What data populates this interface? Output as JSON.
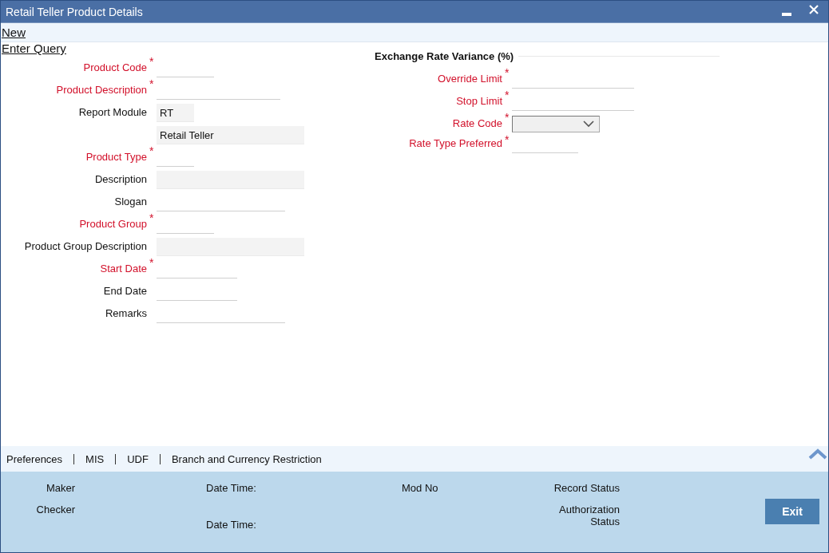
{
  "window": {
    "title": "Retail Teller Product Details"
  },
  "toolbar": {
    "links": [
      "New",
      "Enter Query"
    ]
  },
  "required_marker": "*",
  "fields_left": [
    {
      "label": "Product Code",
      "required": true,
      "kind": "line"
    },
    {
      "label": "Product Description",
      "required": true,
      "kind": "line"
    },
    {
      "label": "Report Module",
      "required": false,
      "kind": "readonly",
      "value": "RT"
    },
    {
      "required": false,
      "kind": "readonly",
      "value": "Retail Teller"
    },
    {
      "label": "Product Type",
      "required": true,
      "kind": "line"
    },
    {
      "label": "Description",
      "required": false,
      "kind": "readonly"
    },
    {
      "label": "Slogan",
      "required": false,
      "kind": "line"
    },
    {
      "label": "Product Group",
      "required": true,
      "kind": "line"
    },
    {
      "label": "Product Group Description",
      "required": false,
      "kind": "readonly"
    },
    {
      "label": "Start Date",
      "required": true,
      "kind": "line"
    },
    {
      "label": "End Date",
      "required": false,
      "kind": "line"
    },
    {
      "label": "Remarks",
      "required": false,
      "kind": "line"
    }
  ],
  "exchange_section": {
    "title": "Exchange Rate Variance (%)",
    "fields": [
      {
        "label": "Override Limit",
        "required": true,
        "kind": "line"
      },
      {
        "label": "Stop Limit",
        "required": true,
        "kind": "line"
      },
      {
        "label": "Rate Code",
        "required": true,
        "kind": "select"
      },
      {
        "label": "Rate Type Preferred",
        "required": true,
        "kind": "line"
      }
    ]
  },
  "bottom_tabs": [
    "Preferences",
    "MIS",
    "UDF",
    "Branch and Currency Restriction"
  ],
  "footer": {
    "maker_label": "Maker",
    "checker_label": "Checker",
    "date_time_labels": [
      "Date Time:",
      "Date Time:"
    ],
    "mod_no_label": "Mod No",
    "record_status_label": "Record Status",
    "authorization_status_label": "Authorization Status"
  },
  "buttons": [
    "Exit"
  ]
}
